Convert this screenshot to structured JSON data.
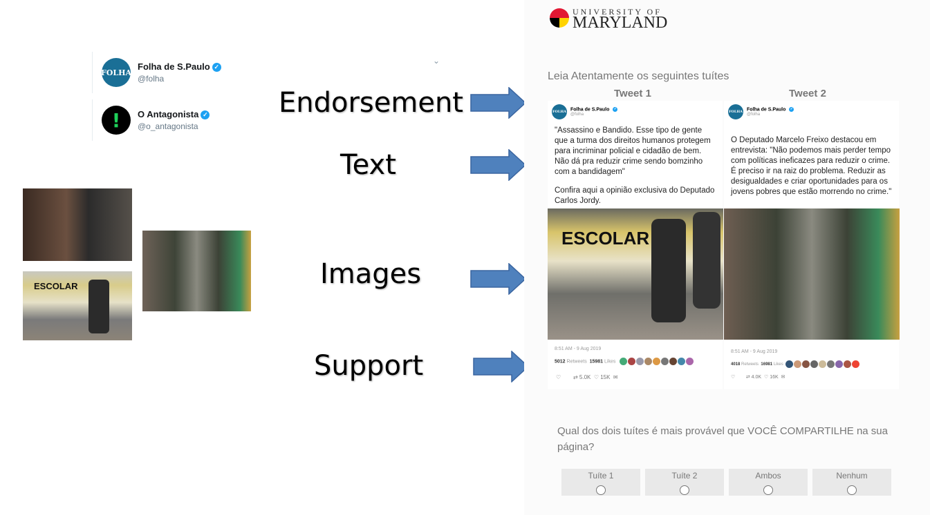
{
  "profiles": [
    {
      "name": "Folha de S.Paulo",
      "handle": "@folha",
      "avatar": "FOLHA"
    },
    {
      "name": "O Antagonista",
      "handle": "@o_antagonista",
      "avatar": "!"
    }
  ],
  "labels": {
    "endorsement": "Endorsement",
    "text": "Text",
    "images": "Images",
    "support": "Support"
  },
  "survey": {
    "logo_top": "UNIVERSITY OF",
    "logo_bottom": "MARYLAND",
    "instruction": "Leia Atentamente os seguintes tuítes",
    "tweets": [
      {
        "title": "Tweet 1",
        "name": "Folha de S.Paulo",
        "handle": "@folha",
        "avatar": "FOLHA",
        "text": "\"Assassino e Bandido. Esse tipo de gente que a turma dos direitos humanos protegem para incriminar policial e cidadão de bem. Não dá pra reduzir crime sendo bomzinho com a bandidagem\"",
        "text2": "Confira aqui a opinião exclusiva do Deputado Carlos Jordy.",
        "image_caption": "ESCOLAR",
        "timestamp": "8:51 AM - 9 Aug 2019",
        "retweets": "5012",
        "retweets_label": "Retweets",
        "likes": "15981",
        "likes_label": "Likes",
        "rt_short": "5.0K",
        "like_short": "15K"
      },
      {
        "title": "Tweet 2",
        "name": "Folha de S.Paulo",
        "handle": "@folha",
        "avatar": "FOLHA",
        "text": "O Deputado Marcelo Freixo destacou em entrevista: \"Não podemos mais perder tempo com políticas ineficazes para reduzir o crime. É preciso ir na raiz do problema. Reduzir as desigualdades e criar oportunidades para os jovens pobres que estão morrendo no crime.\"",
        "text2": "",
        "timestamp": "8:51 AM - 9 Aug 2019",
        "retweets": "4018",
        "retweets_label": "Retweets",
        "likes": "16981",
        "likes_label": "Likes",
        "rt_short": "4.0K",
        "like_short": "16K"
      }
    ],
    "question": "Qual dos dois tuítes é mais provável que VOCÊ COMPARTILHE na sua página?",
    "options": [
      "Tuíte 1",
      "Tuíte 2",
      "Ambos",
      "Nenhum"
    ]
  },
  "left_image_caption": "ESCOLAR"
}
